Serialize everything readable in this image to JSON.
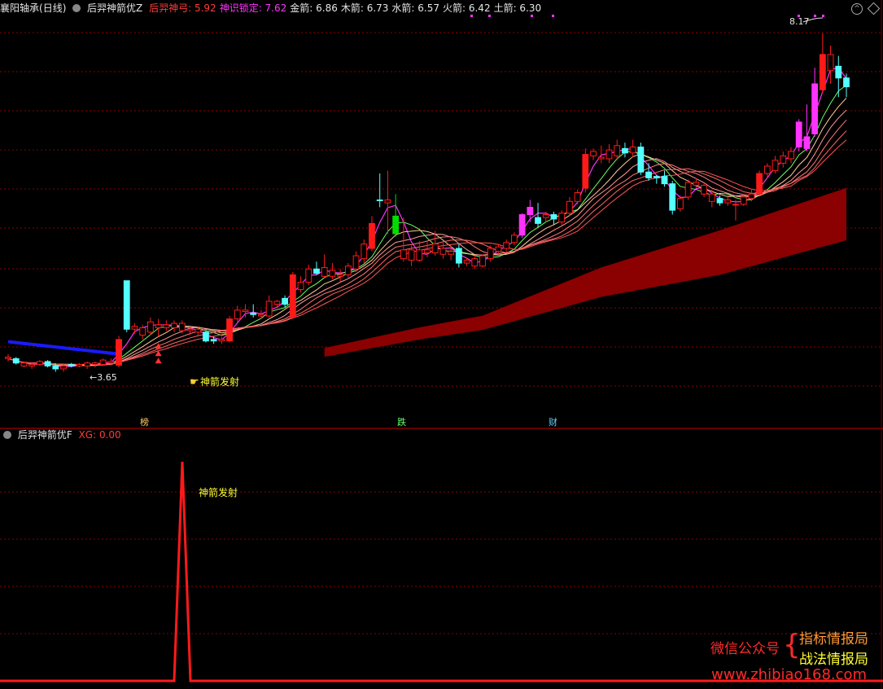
{
  "stock": {
    "name": "襄阳轴承",
    "period": "(日线)"
  },
  "main_indicator": {
    "name": "后羿神箭优Z",
    "items": [
      {
        "label": "后羿神弓",
        "value": "5.92",
        "color": "#ff3b3b"
      },
      {
        "label": "神识锁定",
        "value": "7.62",
        "color": "#ff33ff"
      },
      {
        "label": "金箭",
        "value": "6.86",
        "color": "#e6e6e6"
      },
      {
        "label": "木箭",
        "value": "6.73",
        "color": "#e6e6e6"
      },
      {
        "label": "水箭",
        "value": "6.57",
        "color": "#e6e6e6"
      },
      {
        "label": "火箭",
        "value": "6.42",
        "color": "#e6e6e6"
      },
      {
        "label": "土箭",
        "value": "6.30",
        "color": "#e6e6e6"
      }
    ]
  },
  "sub_indicator": {
    "name": "后羿神箭优F",
    "xg_label": "XG",
    "xg_value": "0.00"
  },
  "annotations": {
    "signal_text": "神箭发射",
    "max_price": "8.17",
    "min_price": "3.65",
    "tag_bang": "榜",
    "tag_die": "跌",
    "tag_cai": "财"
  },
  "watermark": {
    "line1": "微信公众号",
    "brace": "{",
    "line2a": "指标情报局",
    "line2b": "战法情报局",
    "url": "www.zhibiao168.com"
  },
  "colors": {
    "up": "#ff1a1a",
    "down": "#54ffff",
    "magenta": "#ff33ff",
    "green": "#00dd00",
    "band": "#8b0000",
    "blue": "#1a1aff",
    "grid": "#8b0000"
  },
  "chart_data": [
    {
      "type": "candlestick",
      "title": "后羿神箭优Z",
      "ylim": [
        3.3,
        8.4
      ],
      "candles": [
        [
          3.76,
          3.8,
          3.7,
          3.74
        ],
        [
          3.74,
          3.76,
          3.66,
          3.68
        ],
        [
          3.68,
          3.7,
          3.62,
          3.64
        ],
        [
          3.64,
          3.68,
          3.6,
          3.66
        ],
        [
          3.66,
          3.72,
          3.64,
          3.7
        ],
        [
          3.7,
          3.72,
          3.62,
          3.64
        ],
        [
          3.64,
          3.68,
          3.56,
          3.6
        ],
        [
          3.6,
          3.66,
          3.56,
          3.64
        ],
        [
          3.64,
          3.68,
          3.62,
          3.66
        ],
        [
          3.66,
          3.68,
          3.62,
          3.64
        ],
        [
          3.64,
          3.7,
          3.6,
          3.68
        ],
        [
          3.68,
          3.7,
          3.62,
          3.66
        ],
        [
          3.66,
          3.74,
          3.64,
          3.72
        ],
        [
          3.7,
          3.74,
          3.66,
          3.68
        ],
        [
          3.65,
          4.05,
          3.62,
          4.0
        ],
        [
          4.8,
          4.8,
          4.1,
          4.14
        ],
        [
          4.14,
          4.22,
          4.08,
          4.18
        ],
        [
          4.06,
          4.2,
          4.0,
          4.16
        ],
        [
          4.1,
          4.3,
          4.06,
          4.24
        ],
        [
          4.16,
          4.28,
          4.04,
          4.2
        ],
        [
          4.2,
          4.26,
          4.12,
          4.16
        ],
        [
          4.16,
          4.26,
          4.1,
          4.22
        ],
        [
          4.22,
          4.26,
          4.08,
          4.12
        ],
        [
          4.12,
          4.18,
          4.06,
          4.14
        ],
        [
          4.14,
          4.18,
          4.06,
          4.1
        ],
        [
          4.1,
          4.12,
          3.96,
          3.98
        ],
        [
          3.98,
          4.04,
          3.94,
          4.0
        ],
        [
          3.98,
          4.04,
          3.94,
          4.0
        ],
        [
          3.98,
          4.32,
          3.96,
          4.28
        ],
        [
          4.28,
          4.46,
          4.24,
          4.4
        ],
        [
          4.4,
          4.48,
          4.3,
          4.38
        ],
        [
          4.36,
          4.48,
          4.3,
          4.34
        ],
        [
          4.34,
          4.4,
          4.28,
          4.32
        ],
        [
          4.32,
          4.6,
          4.3,
          4.52
        ],
        [
          4.52,
          4.54,
          4.44,
          4.48
        ],
        [
          4.48,
          4.6,
          4.44,
          4.56
        ],
        [
          4.3,
          4.92,
          4.28,
          4.88
        ],
        [
          4.68,
          4.86,
          4.64,
          4.78
        ],
        [
          4.78,
          5.02,
          4.74,
          4.96
        ],
        [
          4.96,
          5.06,
          4.88,
          4.9
        ],
        [
          4.86,
          5.16,
          4.84,
          4.98
        ],
        [
          4.94,
          5.04,
          4.82,
          4.86
        ],
        [
          4.86,
          4.96,
          4.78,
          4.88
        ],
        [
          4.88,
          5.04,
          4.84,
          5.0
        ],
        [
          4.96,
          5.2,
          4.92,
          5.14
        ],
        [
          5.1,
          5.36,
          5.04,
          5.3
        ],
        [
          5.24,
          5.68,
          5.2,
          5.58
        ],
        [
          5.9,
          6.26,
          5.8,
          5.9
        ],
        [
          5.86,
          6.3,
          5.44,
          5.9
        ],
        [
          5.44,
          5.98,
          5.4,
          5.68
        ],
        [
          5.1,
          5.66,
          5.06,
          5.22
        ],
        [
          5.22,
          5.28,
          5.0,
          5.08
        ],
        [
          5.08,
          5.34,
          5.06,
          5.22
        ],
        [
          5.22,
          5.34,
          5.12,
          5.18
        ],
        [
          5.18,
          5.48,
          5.14,
          5.3
        ],
        [
          5.16,
          5.32,
          5.1,
          5.24
        ],
        [
          5.16,
          5.28,
          5.08,
          5.2
        ],
        [
          5.24,
          5.3,
          4.98,
          5.04
        ],
        [
          5.04,
          5.12,
          5.0,
          5.08
        ],
        [
          5.1,
          5.14,
          4.96,
          5.0
        ],
        [
          5.0,
          5.16,
          4.98,
          5.14
        ],
        [
          5.1,
          5.28,
          5.06,
          5.24
        ],
        [
          5.2,
          5.3,
          5.16,
          5.26
        ],
        [
          5.24,
          5.36,
          5.2,
          5.32
        ],
        [
          5.32,
          5.46,
          5.28,
          5.42
        ],
        [
          5.42,
          5.72,
          5.38,
          5.7
        ],
        [
          5.7,
          5.9,
          5.6,
          5.8
        ],
        [
          5.58,
          5.86,
          5.52,
          5.66
        ],
        [
          5.66,
          5.74,
          5.6,
          5.7
        ],
        [
          5.7,
          5.74,
          5.56,
          5.64
        ],
        [
          5.6,
          5.76,
          5.56,
          5.72
        ],
        [
          5.72,
          5.94,
          5.68,
          5.88
        ],
        [
          5.88,
          6.04,
          5.84,
          6.0
        ],
        [
          6.06,
          6.6,
          6.0,
          6.52
        ],
        [
          6.5,
          6.6,
          6.44,
          6.56
        ],
        [
          6.48,
          6.64,
          6.4,
          6.46
        ],
        [
          6.46,
          6.66,
          6.4,
          6.58
        ],
        [
          6.5,
          6.72,
          6.44,
          6.64
        ],
        [
          6.6,
          6.68,
          6.48,
          6.54
        ],
        [
          6.54,
          6.72,
          6.48,
          6.62
        ],
        [
          6.62,
          6.68,
          6.24,
          6.28
        ],
        [
          6.28,
          6.4,
          6.16,
          6.2
        ],
        [
          6.2,
          6.24,
          6.12,
          6.22
        ],
        [
          6.22,
          6.3,
          6.08,
          6.12
        ],
        [
          6.12,
          6.16,
          5.7,
          5.76
        ],
        [
          5.78,
          5.96,
          5.74,
          5.92
        ],
        [
          5.94,
          6.18,
          5.9,
          6.14
        ],
        [
          6.14,
          6.2,
          6.06,
          6.1
        ],
        [
          6.1,
          6.12,
          5.94,
          5.98
        ],
        [
          5.98,
          6.04,
          5.8,
          5.88
        ],
        [
          5.86,
          5.96,
          5.82,
          5.92
        ],
        [
          5.9,
          5.98,
          5.82,
          5.86
        ],
        [
          5.84,
          5.9,
          5.62,
          5.84
        ],
        [
          5.84,
          5.96,
          5.82,
          5.94
        ],
        [
          5.92,
          6.04,
          5.88,
          5.98
        ],
        [
          5.98,
          6.3,
          5.96,
          6.26
        ],
        [
          6.26,
          6.4,
          6.2,
          6.36
        ],
        [
          6.3,
          6.5,
          6.26,
          6.44
        ],
        [
          6.4,
          6.56,
          6.34,
          6.5
        ],
        [
          6.46,
          6.62,
          6.4,
          6.56
        ],
        [
          6.62,
          7.0,
          6.56,
          6.96
        ],
        [
          6.6,
          7.2,
          6.56,
          6.76
        ],
        [
          6.8,
          7.7,
          6.76,
          7.48
        ],
        [
          7.4,
          8.17,
          7.36,
          7.88
        ],
        [
          7.88,
          8.0,
          7.48,
          7.66
        ],
        [
          7.72,
          7.86,
          7.3,
          7.56
        ],
        [
          7.56,
          7.62,
          7.3,
          7.44
        ]
      ],
      "candle_colors": [
        "up",
        "down",
        "up",
        "up",
        "up",
        "down",
        "down",
        "up",
        "down",
        "up",
        "up",
        "up",
        "up",
        "up",
        "up",
        "down",
        "up",
        "up",
        "up",
        "up",
        "up",
        "up",
        "up",
        "up",
        "up",
        "down",
        "down",
        "up",
        "up",
        "up",
        "up",
        "down",
        "up",
        "up",
        "up",
        "down",
        "up",
        "up",
        "up",
        "down",
        "up",
        "up",
        "up",
        "up",
        "up",
        "up",
        "up",
        "down",
        "up",
        "green",
        "up",
        "up",
        "up",
        "up",
        "up",
        "up",
        "up",
        "down",
        "up",
        "up",
        "up",
        "up",
        "up",
        "up",
        "up",
        "mag",
        "mag",
        "down",
        "up",
        "down",
        "up",
        "up",
        "up",
        "up",
        "up",
        "up",
        "up",
        "up",
        "down",
        "up",
        "down",
        "down",
        "down",
        "down",
        "down",
        "up",
        "up",
        "up",
        "up",
        "up",
        "down",
        "up",
        "up",
        "up",
        "up",
        "up",
        "up",
        "up",
        "up",
        "up",
        "mag",
        "mag",
        "mag",
        "up",
        "up",
        "down",
        "down"
      ],
      "band": [
        [
          0,
          3.0,
          3.0
        ],
        [
          52,
          4.02,
          4.02
        ],
        [
          60,
          4.15,
          4.15
        ],
        [
          75,
          4.6,
          4.75
        ],
        [
          90,
          4.9,
          5.2
        ],
        [
          107,
          5.4,
          5.75
        ]
      ],
      "signal_index": 19,
      "max_index": 103,
      "min_index": 7
    },
    {
      "type": "line",
      "title": "后羿神箭优F",
      "series": [
        {
          "name": "XG",
          "values": [
            0,
            0,
            0,
            0,
            0,
            0,
            0,
            0,
            0,
            0,
            0,
            0,
            0,
            0,
            0,
            0,
            0,
            0,
            0,
            1,
            0,
            0,
            0,
            0,
            0,
            0,
            0,
            0,
            0,
            0,
            0,
            0,
            0,
            0,
            0,
            0,
            0,
            0,
            0,
            0,
            0,
            0,
            0,
            0,
            0,
            0,
            0,
            0,
            0,
            0,
            0,
            0,
            0,
            0,
            0,
            0,
            0,
            0,
            0,
            0,
            0,
            0,
            0,
            0,
            0,
            0,
            0,
            0,
            0,
            0,
            0,
            0,
            0,
            0,
            0,
            0,
            0,
            0,
            0,
            0,
            0,
            0,
            0,
            0,
            0,
            0,
            0,
            0,
            0,
            0,
            0,
            0,
            0,
            0,
            0,
            0,
            0,
            0,
            0,
            0,
            0,
            0,
            0,
            0,
            0,
            0,
            0
          ]
        }
      ],
      "ylim": [
        0,
        1.1
      ]
    }
  ]
}
